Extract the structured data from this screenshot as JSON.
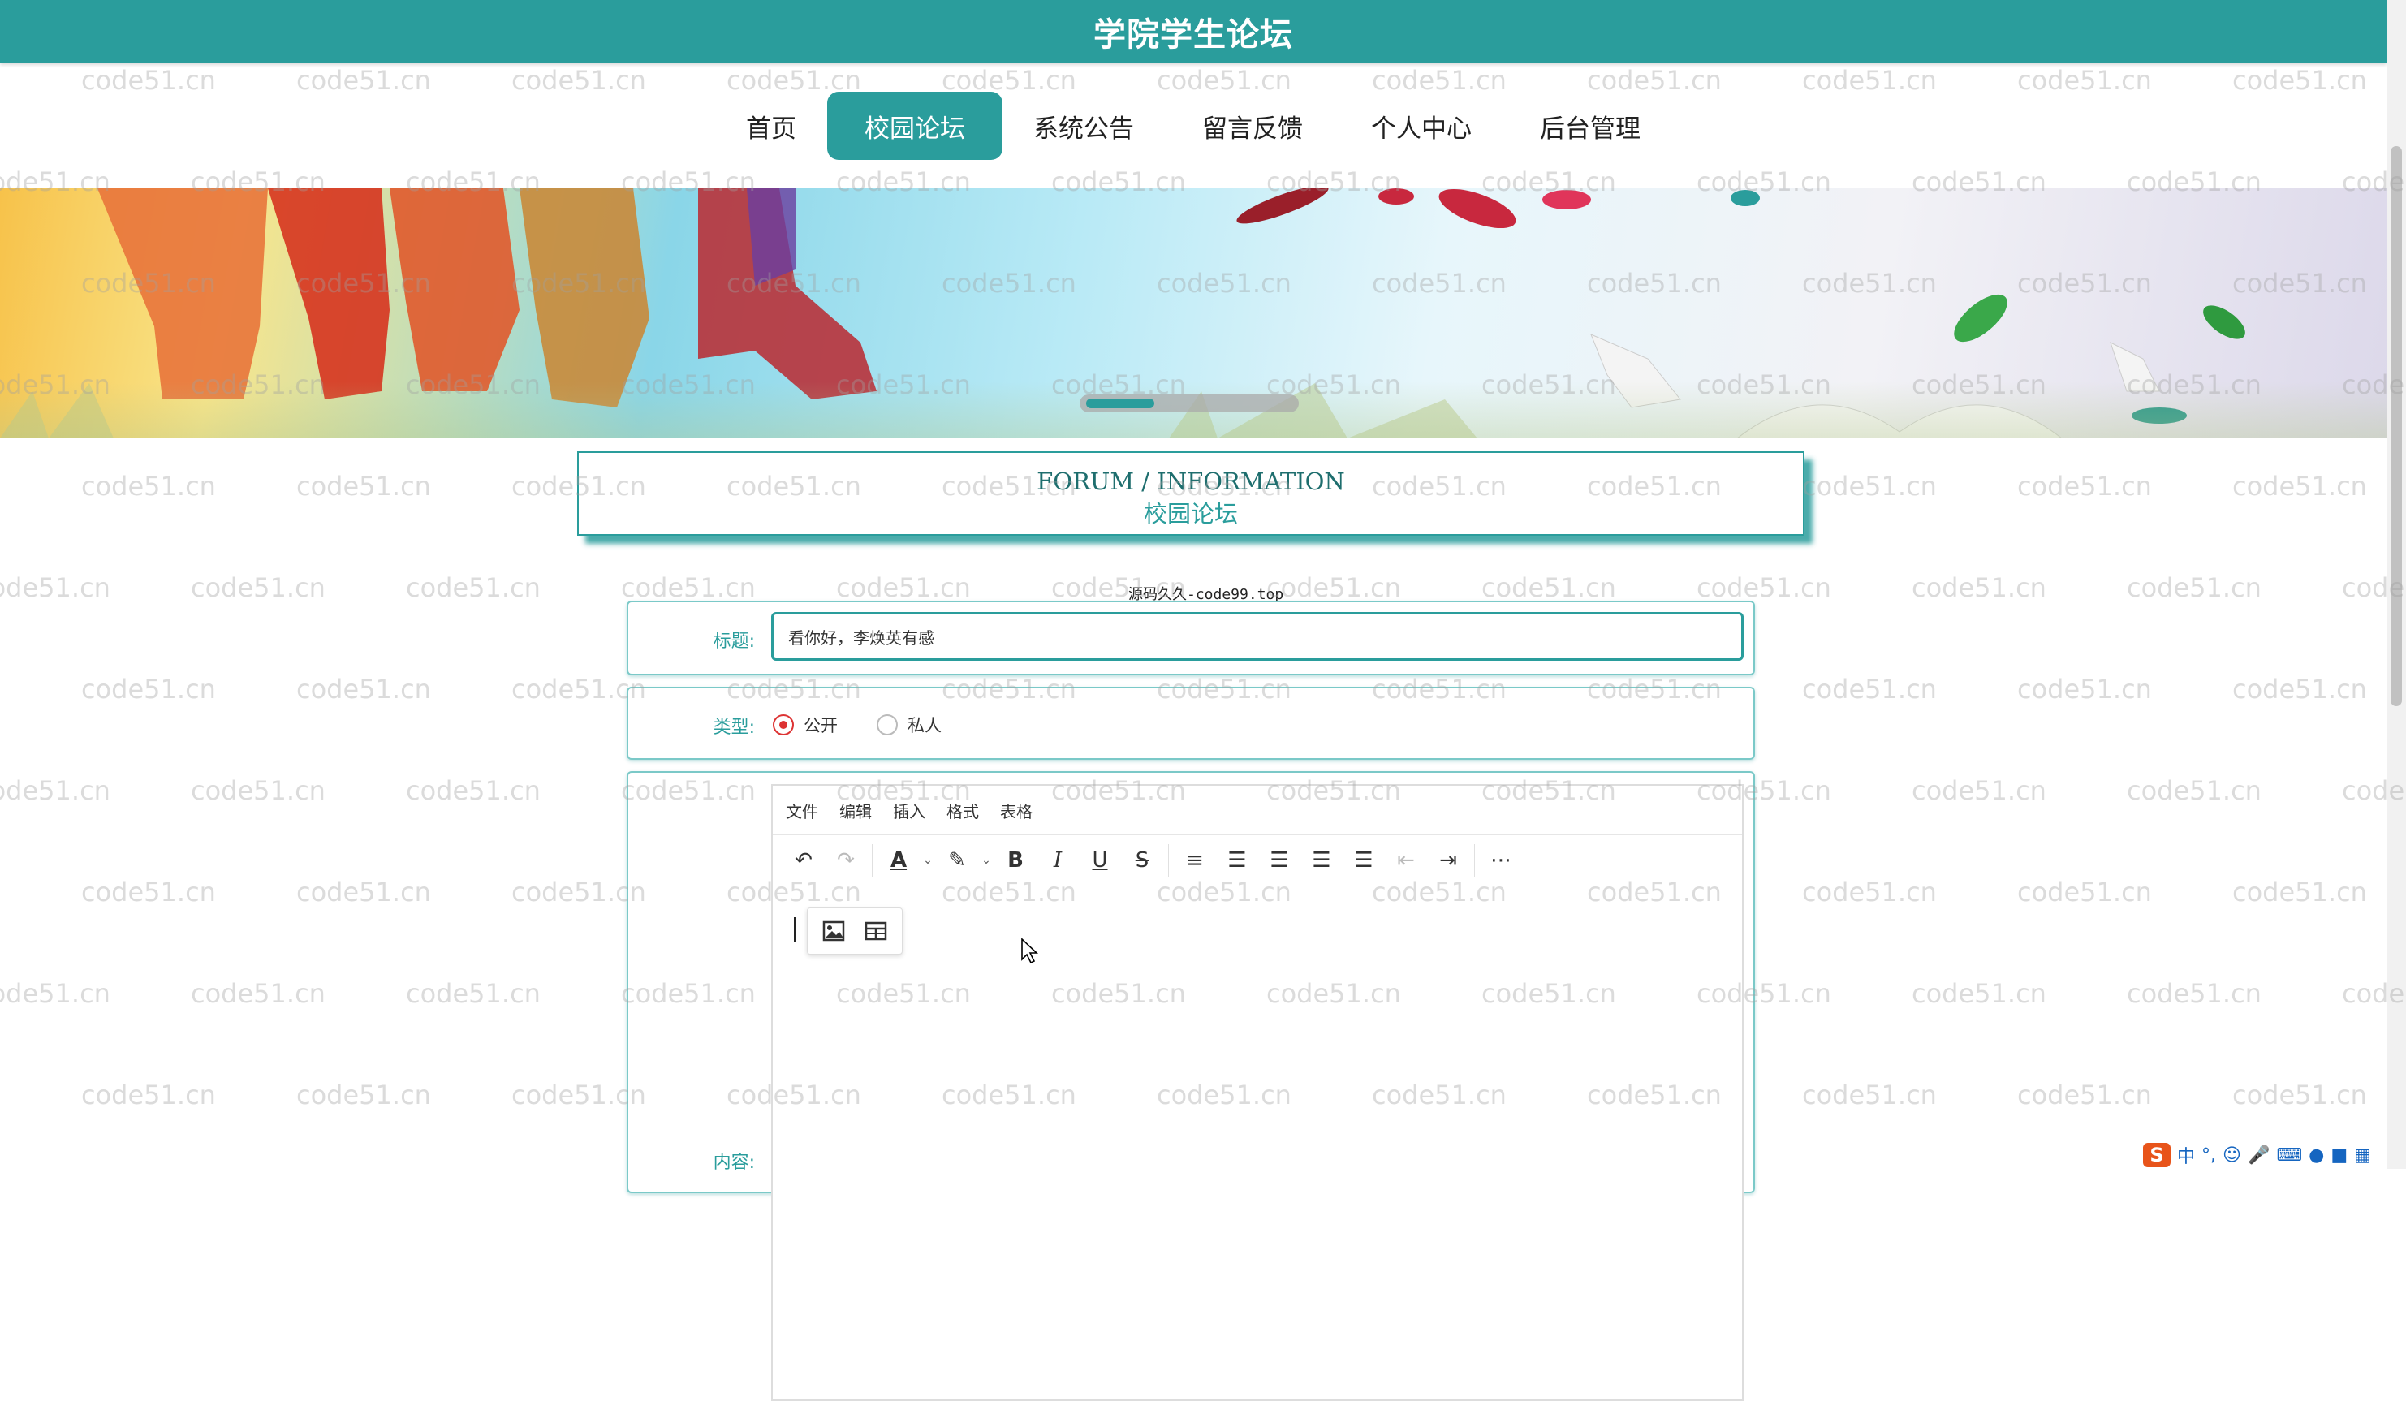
{
  "site": {
    "title": "学院学生论坛"
  },
  "nav": {
    "items": [
      {
        "label": "首页",
        "active": false
      },
      {
        "label": "校园论坛",
        "active": true
      },
      {
        "label": "系统公告",
        "active": false
      },
      {
        "label": "留言反馈",
        "active": false
      },
      {
        "label": "个人中心",
        "active": false
      },
      {
        "label": "后台管理",
        "active": false
      }
    ]
  },
  "banner": {
    "total_slides": 3,
    "active_slide": 1
  },
  "section": {
    "title_en": "FORUM / INFORMATION",
    "title_cn": "校园论坛"
  },
  "source_note": "源码久久-code99.top",
  "form": {
    "title_label": "标题:",
    "title_value": "看你好，李焕英有感",
    "type_label": "类型:",
    "type_options": [
      {
        "label": "公开",
        "checked": true
      },
      {
        "label": "私人",
        "checked": false
      }
    ],
    "content_label": "内容:"
  },
  "editor": {
    "menus": [
      "文件",
      "编辑",
      "插入",
      "格式",
      "表格"
    ],
    "toolbar_icons": [
      "undo-icon",
      "redo-icon",
      "text-color-icon",
      "highlight-icon",
      "bold-icon",
      "italic-icon",
      "underline-icon",
      "strikethrough-icon",
      "line-height-icon",
      "align-left-icon",
      "align-center-icon",
      "align-right-icon",
      "align-justify-icon",
      "outdent-icon",
      "indent-icon",
      "more-icon"
    ],
    "quick_insert_icons": [
      "image-icon",
      "table-icon"
    ],
    "text_color": "#333333",
    "highlight_color": "#333333"
  },
  "watermark": "code51.cn",
  "colors": {
    "accent": "#2a9d9c",
    "radio_checked": "#dd3333"
  },
  "ime": {
    "mode_label": "中"
  }
}
